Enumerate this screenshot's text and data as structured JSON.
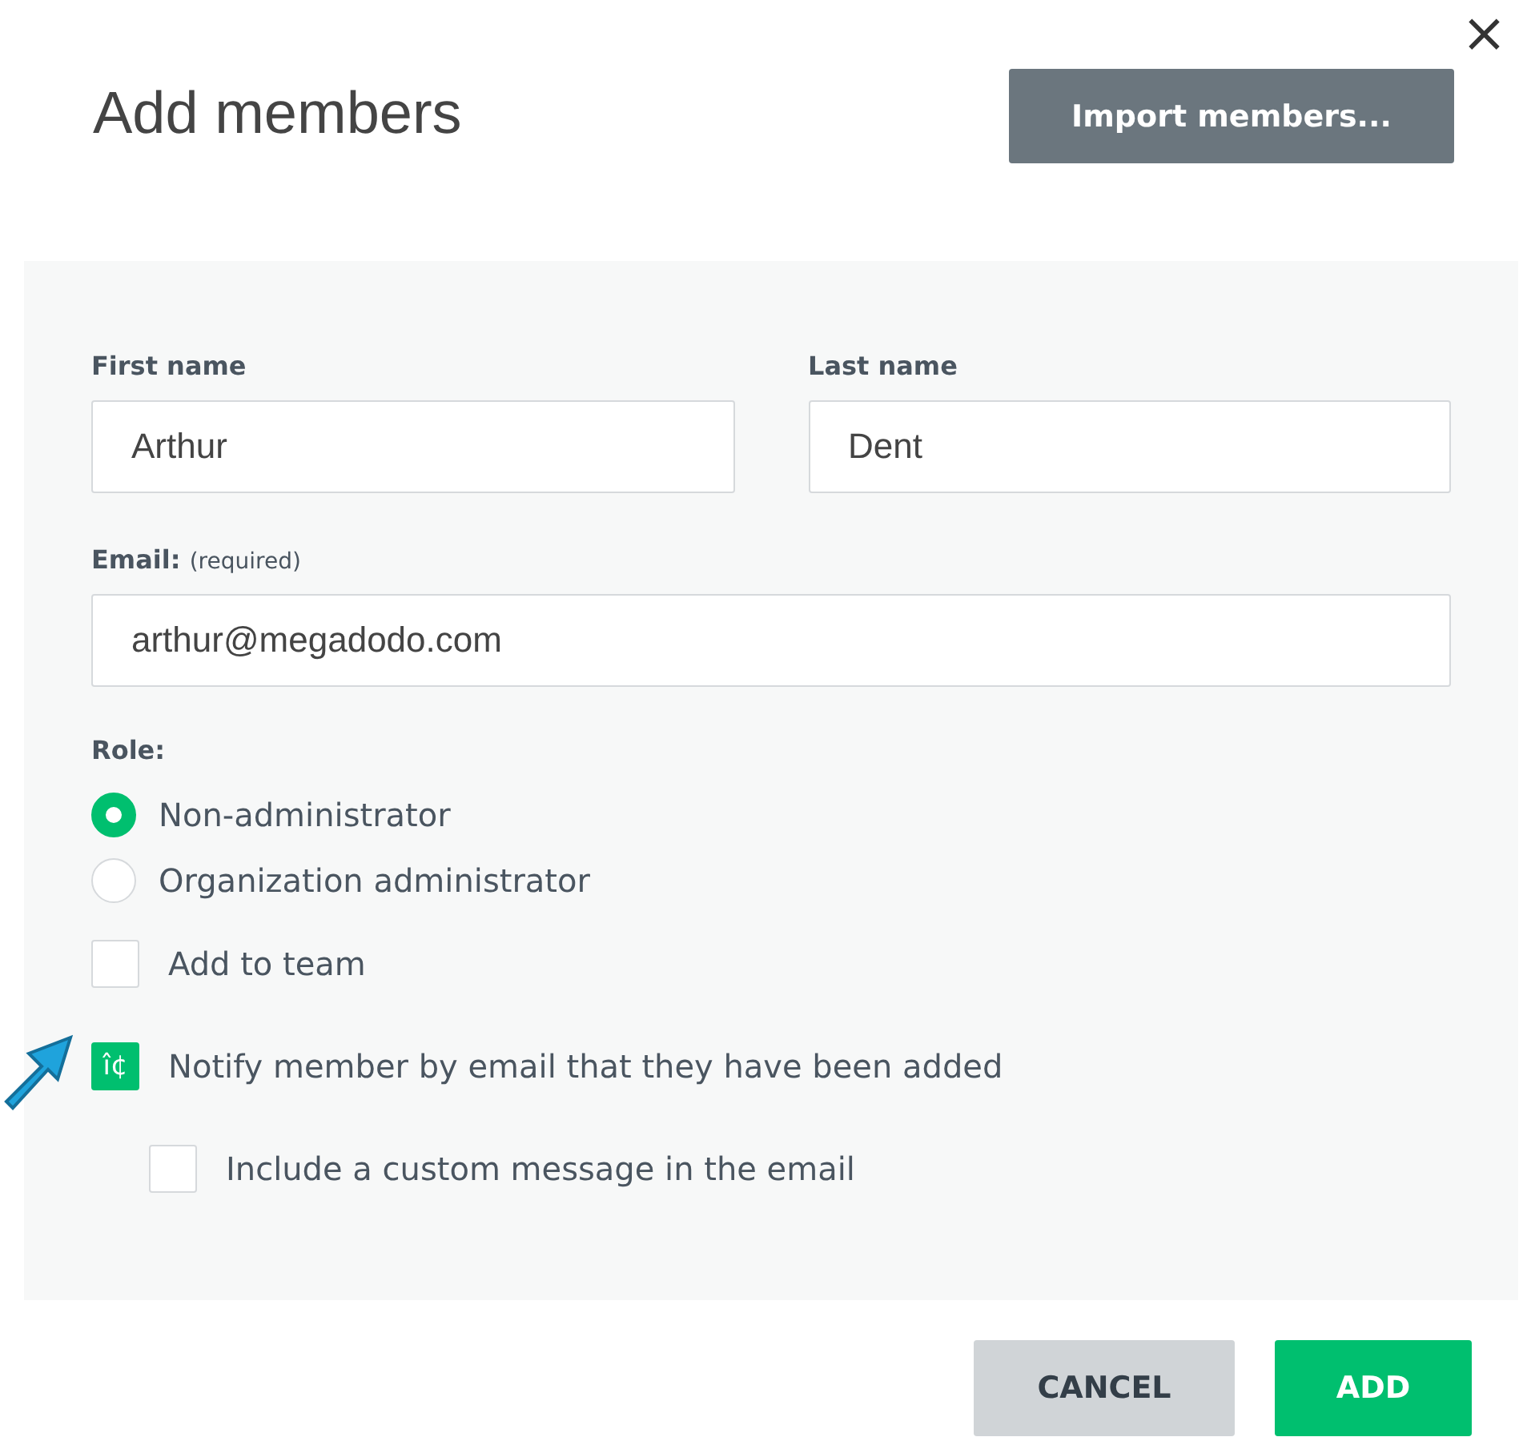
{
  "dialog": {
    "title": "Add members",
    "close": "×",
    "import_button": "Import members..."
  },
  "fields": [
    {
      "label": "First name",
      "value": "Arthur"
    },
    {
      "label": "Last name",
      "value": "Dent"
    }
  ],
  "email": {
    "label": "Email:",
    "hint": "(required)",
    "value": "arthur@megadodo.com"
  },
  "role": {
    "label": "Role:",
    "options": [
      {
        "label": "Non-administrator",
        "selected": true
      },
      {
        "label": "Organization administrator",
        "selected": false
      }
    ]
  },
  "checkboxes": [
    {
      "label": "Add to team",
      "checked": false
    },
    {
      "label": "Notify member by email that they have been added",
      "checked": true,
      "glyph": "î¢",
      "children": [
        {
          "label": "Include a custom message in the email",
          "checked": false
        }
      ]
    }
  ],
  "buttons": [
    {
      "label": "CANCEL",
      "kind": "secondary"
    },
    {
      "label": "ADD",
      "kind": "primary"
    }
  ]
}
